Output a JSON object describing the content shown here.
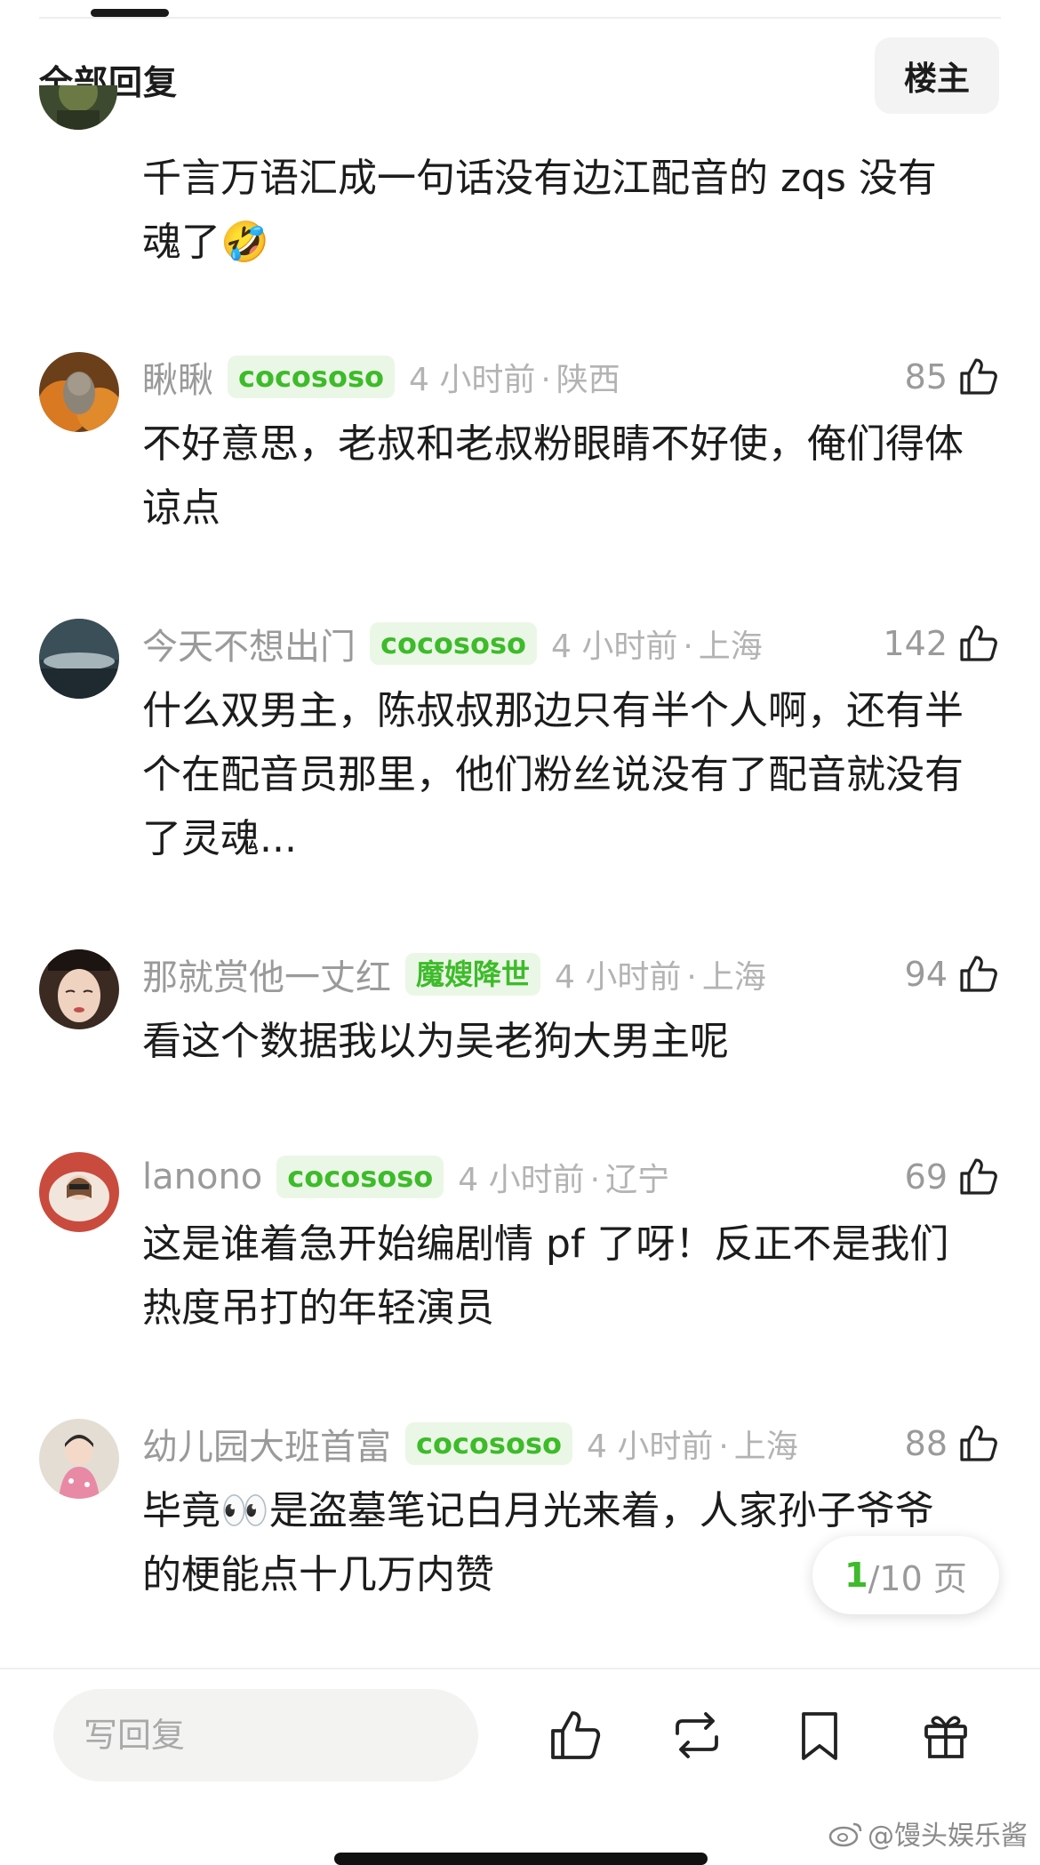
{
  "header": {
    "title": "全部回复",
    "owner_button": "楼主"
  },
  "comments": [
    {
      "content": "千言万语汇成一句话没有边江配音的 zqs 没有魂了🤣"
    },
    {
      "username": "瞅瞅",
      "badge": "cocososo",
      "time": "4 小时前",
      "location": "陕西",
      "likes": "85",
      "content": "不好意思，老叔和老叔粉眼睛不好使，俺们得体谅点"
    },
    {
      "username": "今天不想出门",
      "badge": "cocososo",
      "time": "4 小时前",
      "location": "上海",
      "likes": "142",
      "content": "什么双男主，陈叔叔那边只有半个人啊，还有半个在配音员那里，他们粉丝说没有了配音就没有了灵魂..."
    },
    {
      "username": "那就赏他一丈红",
      "badge": "魔嫂降世",
      "time": "4 小时前",
      "location": "上海",
      "likes": "94",
      "content": "看这个数据我以为吴老狗大男主呢"
    },
    {
      "username": "lanono",
      "badge": "cocososo",
      "time": "4 小时前",
      "location": "辽宁",
      "likes": "69",
      "content": "这是谁着急开始编剧情 pf 了呀！反正不是我们热度吊打的年轻演员"
    },
    {
      "username": "幼儿园大班首富",
      "badge": "cocososo",
      "time": "4 小时前",
      "location": "上海",
      "likes": "88",
      "content": "毕竟👀是盗墓笔记白月光来着，人家孙子爷爷的梗能点十几万内赞"
    }
  ],
  "pagination": {
    "current": "1",
    "total_text": "/10 页"
  },
  "bottom_bar": {
    "reply_placeholder": "写回复"
  },
  "watermark": "@馒头娱乐酱",
  "colors": {
    "accent_green": "#3dbb2a",
    "badge_bg": "#ebf7e6",
    "muted_text": "#9a9a9a"
  },
  "icons": [
    "thumbs-up-icon",
    "repost-icon",
    "bookmark-icon",
    "gift-icon",
    "weibo-logo-icon"
  ]
}
